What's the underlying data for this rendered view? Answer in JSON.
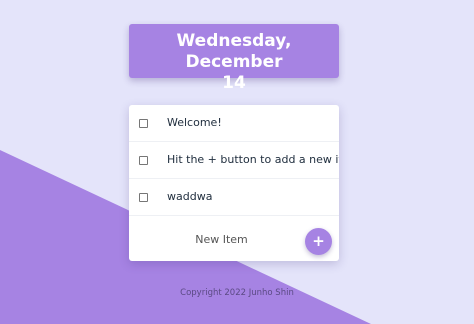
{
  "header": {
    "date_line1": "Wednesday, December",
    "date_line2": "14"
  },
  "todo": {
    "items": [
      {
        "label": "Welcome!",
        "checked": false
      },
      {
        "label": "Hit the + button to add a new item",
        "checked": false
      },
      {
        "label": "waddwa",
        "checked": false
      }
    ],
    "new_item_placeholder": "New Item",
    "add_button_label": "+"
  },
  "footer": {
    "copyright": "Copyright 2022 Junho Shin"
  },
  "colors": {
    "background": "#e4e4fa",
    "accent": "#a683e3",
    "card": "#ffffff"
  },
  "icons": {
    "add": "plus-icon",
    "checkbox": "checkbox-icon"
  }
}
